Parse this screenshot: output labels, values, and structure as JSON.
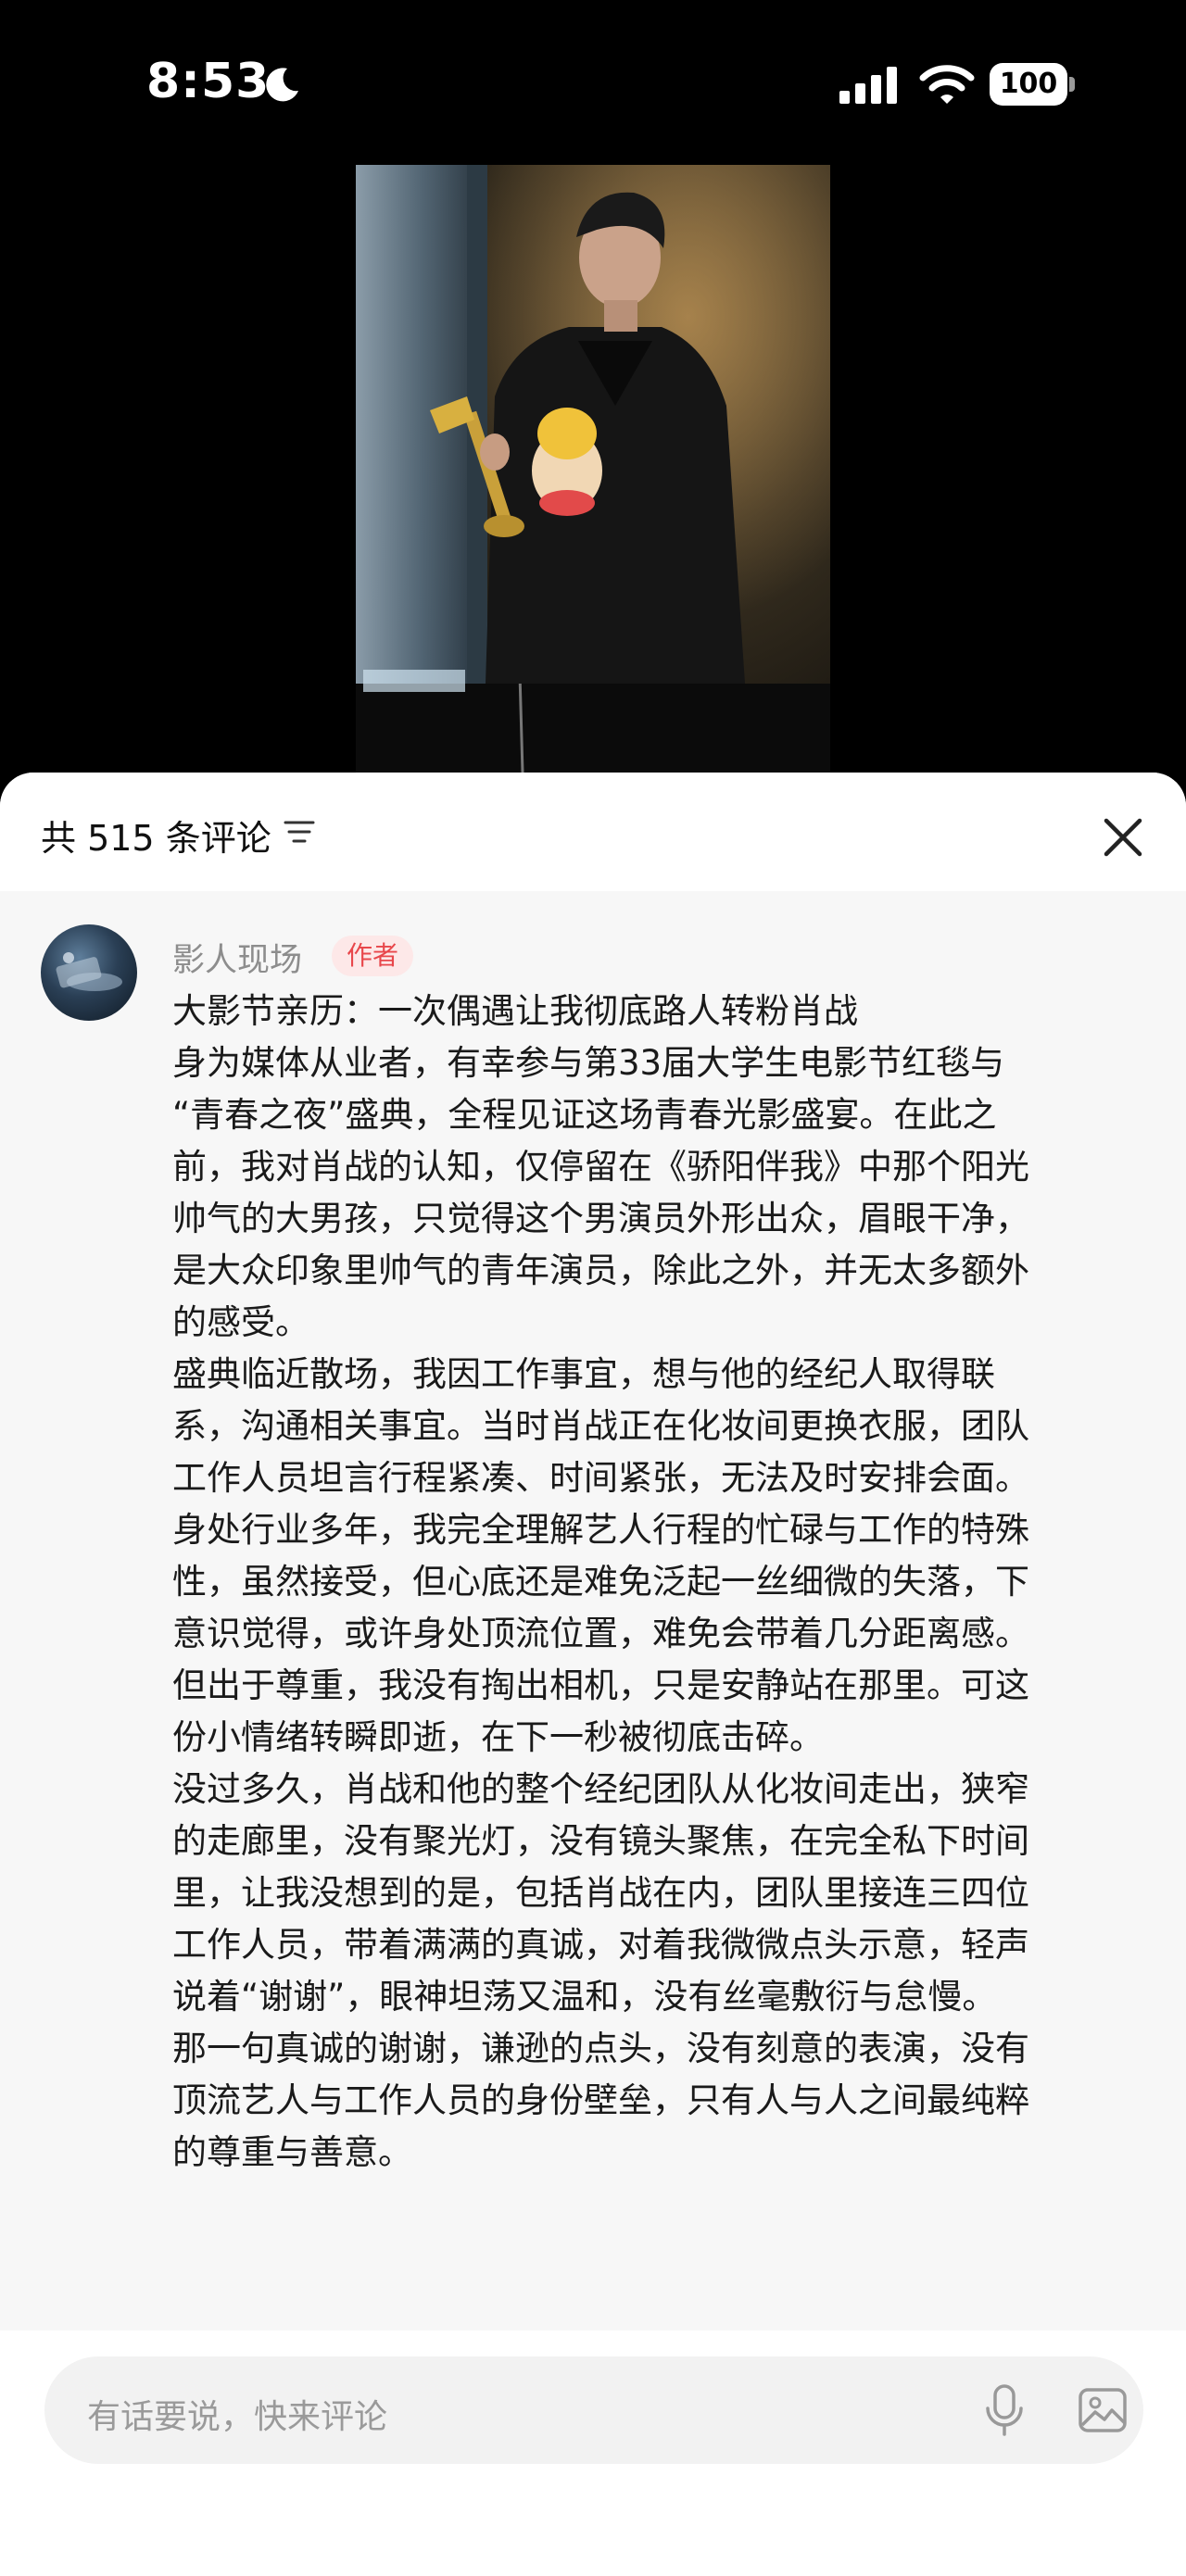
{
  "status_bar": {
    "time": "8:53",
    "battery": "100",
    "icons": [
      "moon-icon",
      "cellular-signal-icon",
      "wifi-icon",
      "battery-icon"
    ]
  },
  "video": {
    "type": "video-thumbnail",
    "subject": "man in dark suit holding trophy and mascot plush"
  },
  "comments_panel": {
    "count_label": "共 515 条评论",
    "icons": {
      "filter": "filter-icon",
      "close": "close-icon"
    }
  },
  "comment": {
    "username": "影人现场",
    "badge": "作者",
    "lines": [
      "大影节亲历：一次偶遇让我彻底路人转粉肖战",
      "身为媒体从业者，有幸参与第33届大学生电影节红毯与",
      "“青春之夜”盛典，全程见证这场青春光影盛宴。在此之",
      "前，我对肖战的认知，仅停留在《骄阳伴我》中那个阳光",
      "帅气的大男孩，只觉得这个男演员外形出众，眉眼干净，",
      "是大众印象里帅气的青年演员，除此之外，并无太多额外",
      "的感受。",
      "盛典临近散场，我因工作事宜，想与他的经纪人取得联",
      "系，沟通相关事宜。当时肖战正在化妆间更换衣服，团队",
      "工作人员坦言行程紧凑、时间紧张，无法及时安排会面。",
      "身处行业多年，我完全理解艺人行程的忙碌与工作的特殊",
      "性，虽然接受，但心底还是难免泛起一丝细微的失落，下",
      "意识觉得，或许身处顶流位置，难免会带着几分距离感。",
      "但出于尊重，我没有掏出相机，只是安静站在那里。可这",
      "份小情绪转瞬即逝，在下一秒被彻底击碎。",
      "没过多久，肖战和他的整个经纪团队从化妆间走出，狭窄",
      "的走廊里，没有聚光灯，没有镜头聚焦，在完全私下时间",
      "里，让我没想到的是，包括肖战在内，团队里接连三四位",
      "工作人员，带着满满的真诚，对着我微微点头示意，轻声",
      "说着“谢谢”，眼神坦荡又温和，没有丝毫敷衍与怠慢。",
      "那一句真诚的谢谢，谦逊的点头，没有刻意的表演，没有",
      "顶流艺人与工作人员的身份壁垒，只有人与人之间最纯粹",
      "的尊重与善意。"
    ]
  },
  "input": {
    "placeholder": "有话要说，快来评论",
    "icons": {
      "mic": "microphone-icon",
      "image": "image-icon"
    }
  },
  "colors": {
    "badge_bg": "#fde8e8",
    "badge_text": "#e8474b",
    "panel_bg": "#f7f7f7"
  }
}
